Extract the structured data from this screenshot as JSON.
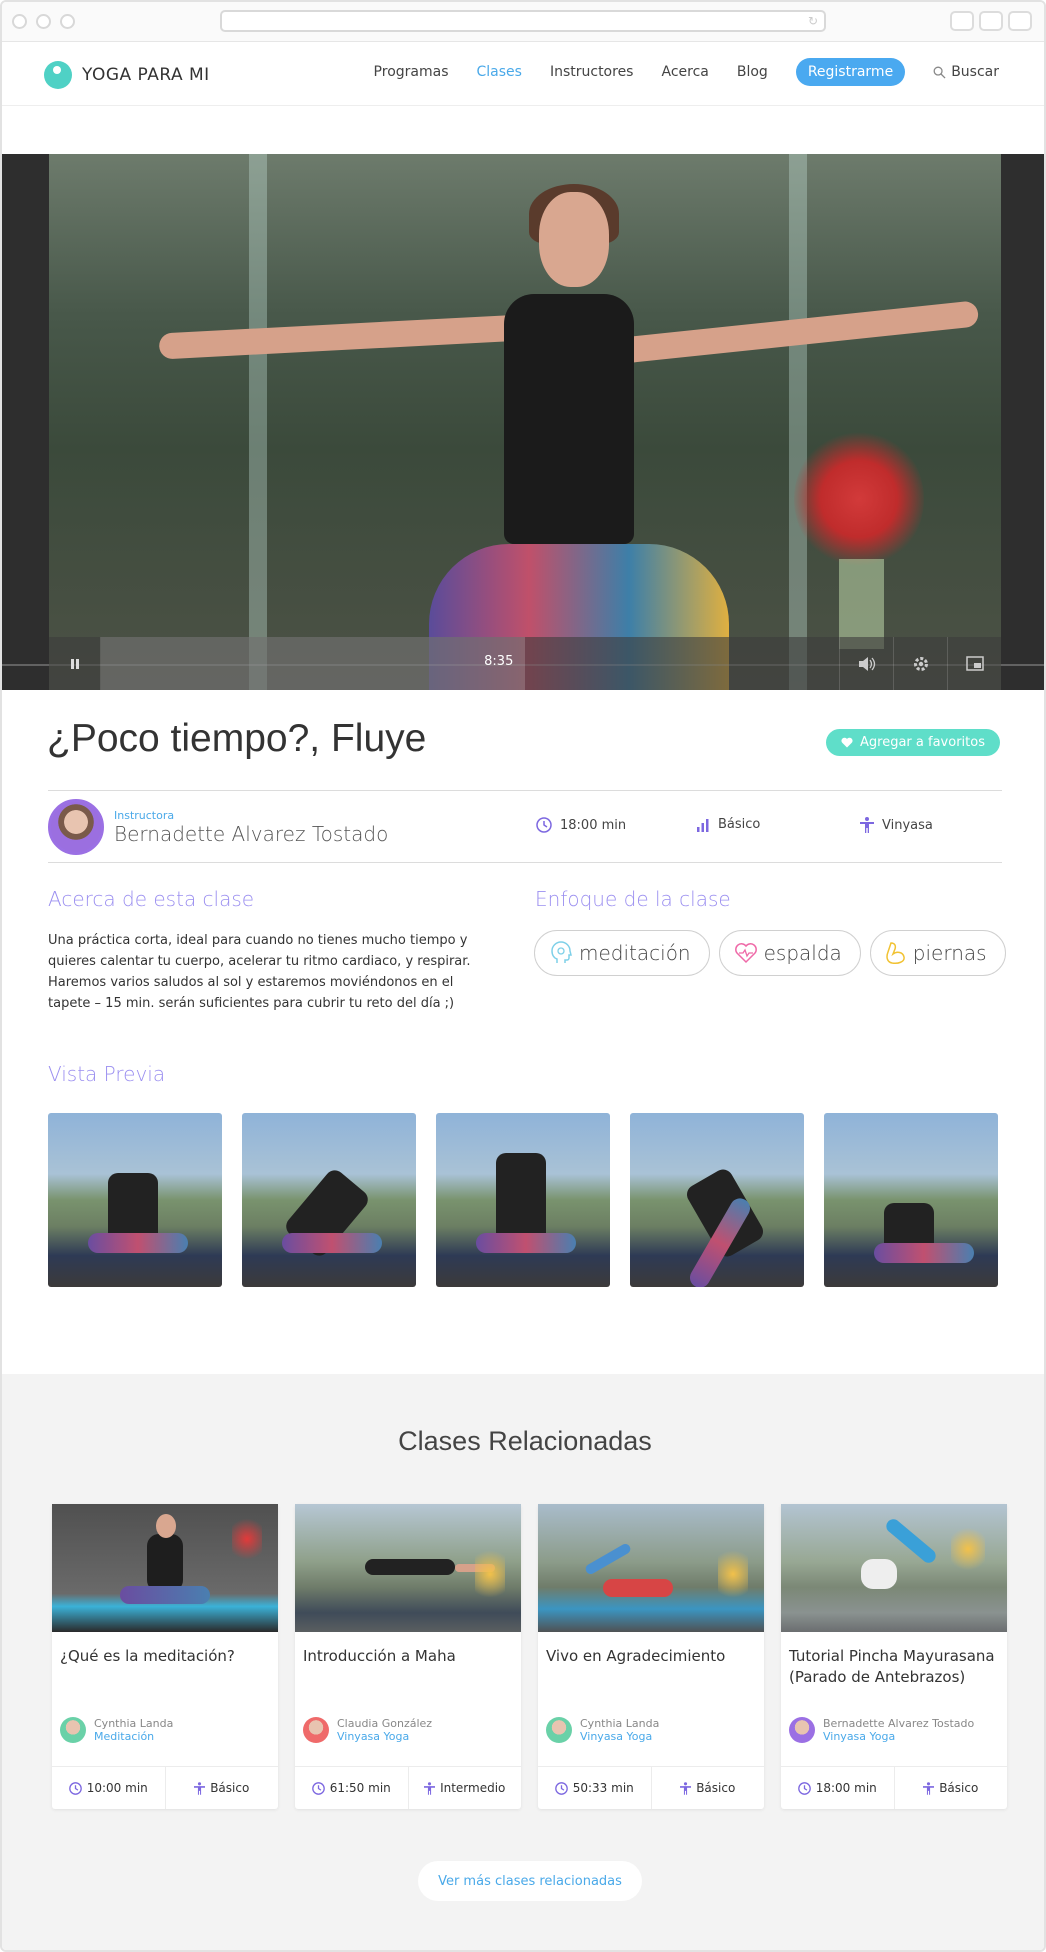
{
  "nav": {
    "logo": "YOGA PARA MI",
    "items": [
      "Programas",
      "Clases",
      "Instructores",
      "Acerca",
      "Blog"
    ],
    "register": "Registrarme",
    "search": "Buscar"
  },
  "video": {
    "time": "8:35",
    "progress": 0.46
  },
  "class": {
    "title": "¿Poco tiempo?, Fluye",
    "favorite_button": "Agregar a favoritos",
    "instructor_label": "Instructora",
    "instructor_name": "Bernadette Alvarez Tostado",
    "duration": "18:00 min",
    "level": "Básico",
    "style": "Vinyasa",
    "about_heading": "Acerca de esta clase",
    "about_text": "Una práctica corta, ideal para cuando no tienes mucho tiempo y quieres calentar tu cuerpo, acelerar tu ritmo cardiaco, y respirar. Haremos varios saludos al sol y estaremos moviéndonos en el tapete – 15 min. serán suficientes para cubrir tu reto del día ;)",
    "focus_heading": "Enfoque de la clase",
    "focus_tags": [
      "meditación",
      "espalda",
      "piernas"
    ],
    "preview_heading": "Vista Previa"
  },
  "related": {
    "title": "Clases Relacionadas",
    "cards": [
      {
        "title": "¿Qué es la meditación?",
        "instructor": "Cynthia Landa",
        "style": "Meditación",
        "duration": "10:00 min",
        "level": "Básico"
      },
      {
        "title": "Introducción a Maha",
        "instructor": "Claudia González",
        "style": "Vinyasa Yoga",
        "duration": "61:50 min",
        "level": "Intermedio"
      },
      {
        "title": "Vivo en Agradecimiento",
        "instructor": "Cynthia Landa",
        "style": "Vinyasa Yoga",
        "duration": "50:33 min",
        "level": "Básico"
      },
      {
        "title": "Tutorial Pincha Mayurasana (Parado de Antebrazos)",
        "instructor": "Bernadette Alvarez Tostado",
        "style": "Vinyasa Yoga",
        "duration": "18:00 min",
        "level": "Básico"
      }
    ],
    "more_button": "Ver más clases relacionadas"
  },
  "colors": {
    "accent_blue": "#4aa9e9",
    "accent_teal": "#5fdec9",
    "accent_violet": "#9b8ff0"
  }
}
